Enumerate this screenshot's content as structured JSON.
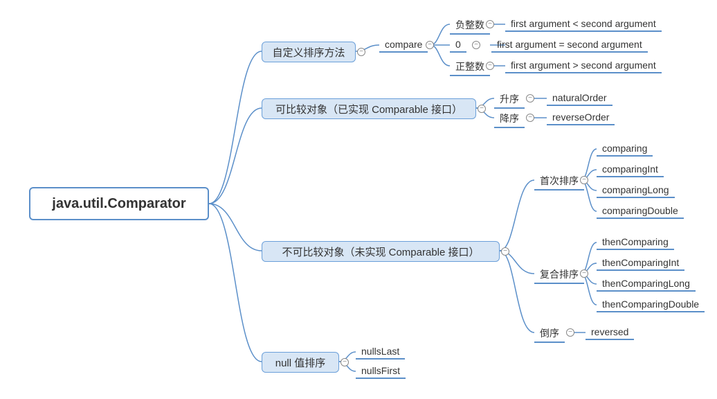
{
  "root": "java.util.Comparator",
  "branch1": "自定义排序方法",
  "branch1_leaf1": "compare",
  "branch1_l1_c1_key": "负整数",
  "branch1_l1_c1_val": "first argument < second argument",
  "branch1_l1_c2_key": "0",
  "branch1_l1_c2_val": "first argument = second argument",
  "branch1_l1_c3_key": "正整数",
  "branch1_l1_c3_val": "first argument > second argument",
  "branch2": "可比较对象（已实现 Comparable 接口）",
  "branch2_c1_key": "升序",
  "branch2_c1_val": "naturalOrder",
  "branch2_c2_key": "降序",
  "branch2_c2_val": "reverseOrder",
  "branch3": "不可比较对象（未实现 Comparable 接口）",
  "branch3_c1": "首次排序",
  "branch3_c1_1": "comparing",
  "branch3_c1_2": "comparingInt",
  "branch3_c1_3": "comparingLong",
  "branch3_c1_4": "comparingDouble",
  "branch3_c2": "复合排序",
  "branch3_c2_1": "thenComparing",
  "branch3_c2_2": "thenComparingInt",
  "branch3_c2_3": "thenComparingLong",
  "branch3_c2_4": "thenComparingDouble",
  "branch3_c3": "倒序",
  "branch3_c3_1": "reversed",
  "branch4": "null 值排序",
  "branch4_c1": "nullsLast",
  "branch4_c2": "nullsFirst"
}
